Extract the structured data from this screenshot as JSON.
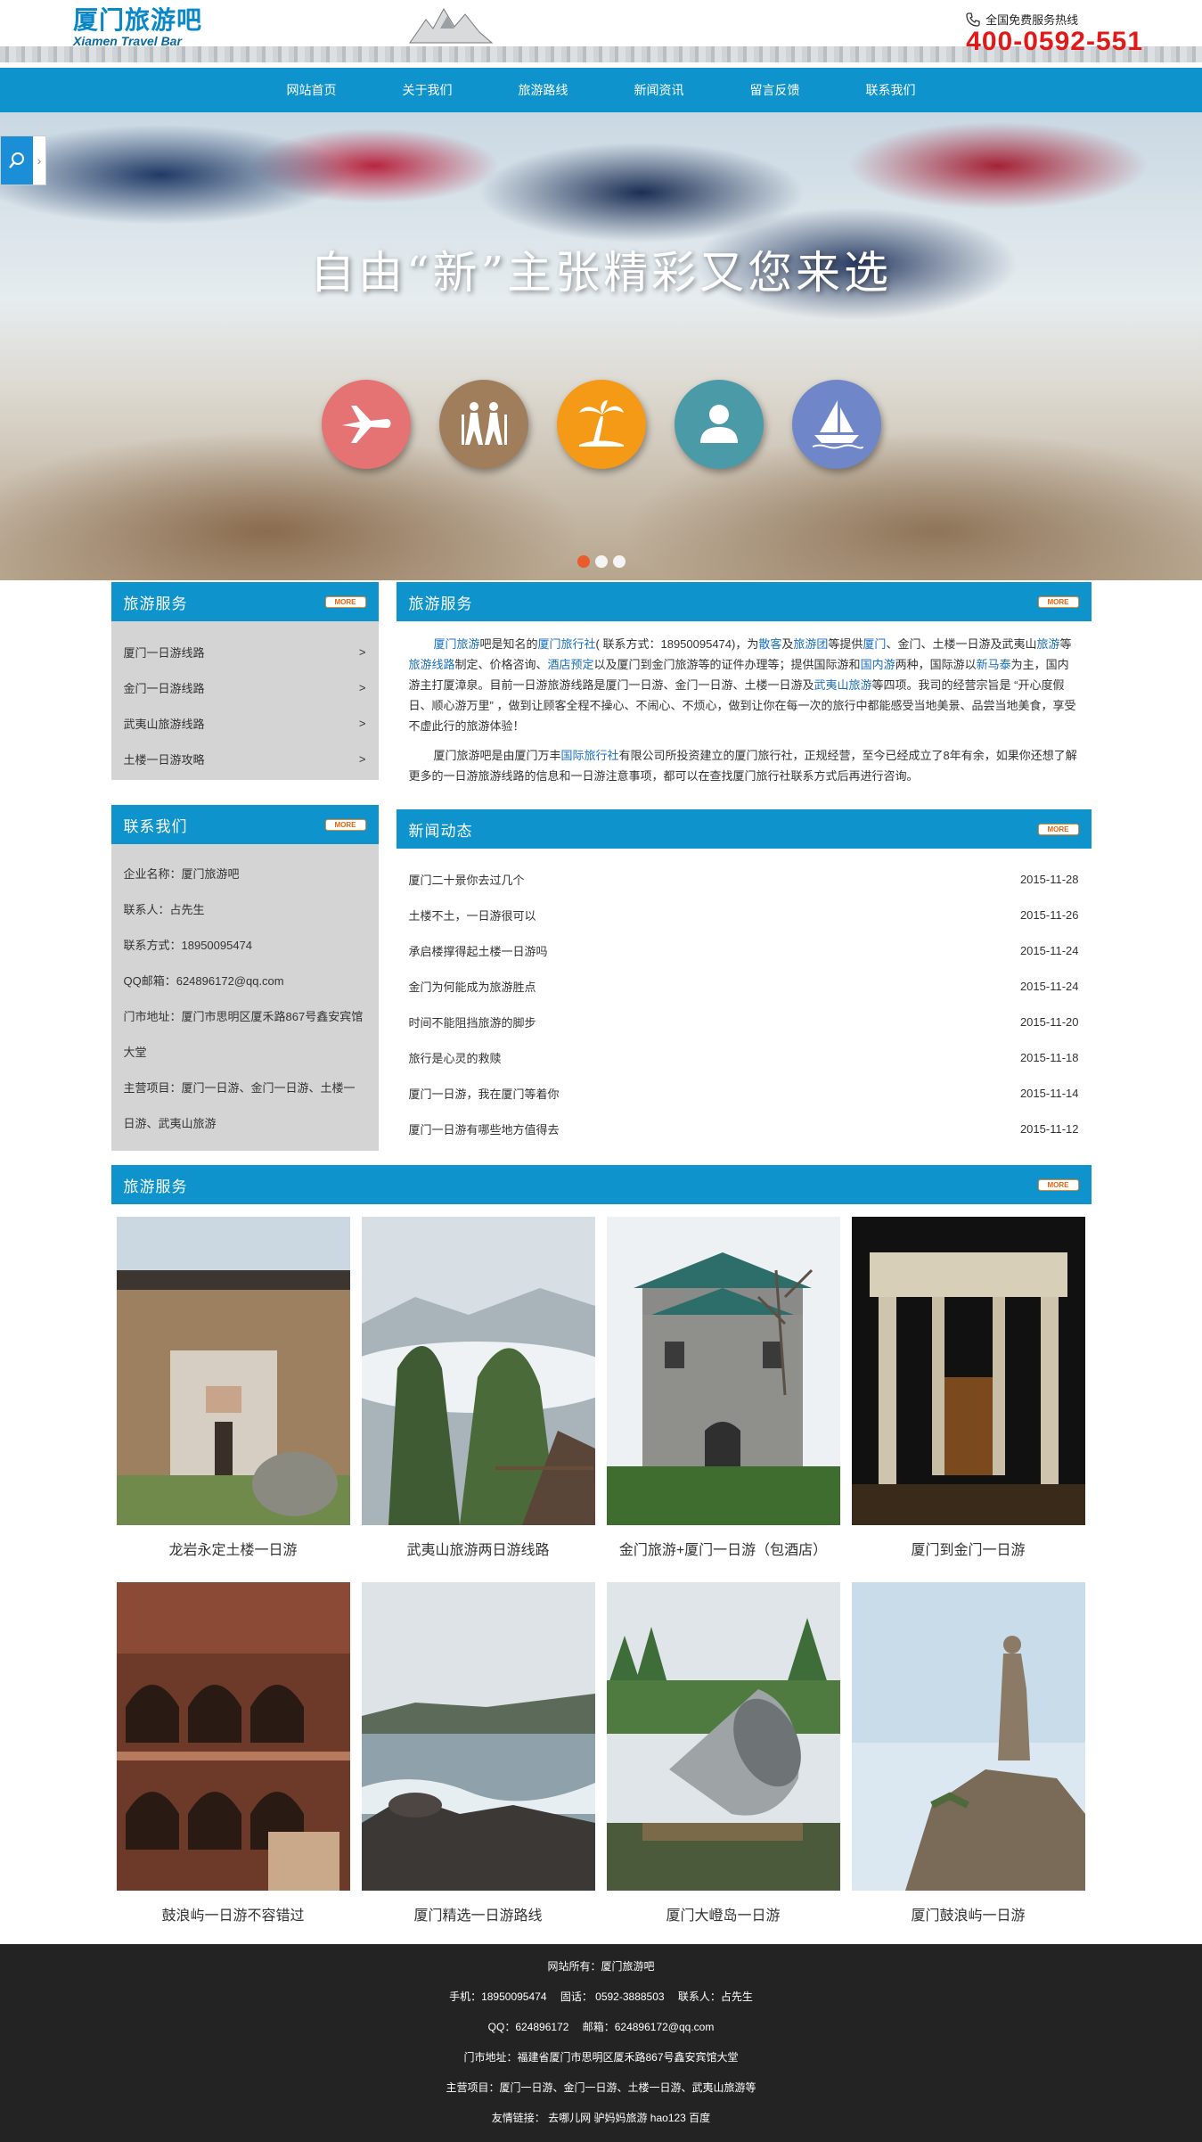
{
  "header": {
    "logo_cn": "厦门旅游吧",
    "logo_en": "Xiamen Travel Bar",
    "hotline_label": "全国免费服务热线",
    "hotline_number": "400-0592-551"
  },
  "nav": {
    "items": [
      "网站首页",
      "关于我们",
      "旅游路线",
      "新闻资讯",
      "留言反馈",
      "联系我们"
    ]
  },
  "banner": {
    "slogan": "自由“新”主张精彩又您来选",
    "icons": [
      "airplane-icon",
      "hikers-icon",
      "palm-tree-icon",
      "person-icon",
      "sailboat-icon"
    ],
    "icon_colors": [
      "#e57373",
      "#a07e5c",
      "#f59a17",
      "#4b9aa8",
      "#6f86c9"
    ],
    "active_slide": 1,
    "slide_count": 3
  },
  "colors": {
    "primary": "#0e93cc",
    "accent_red": "#e11919",
    "link": "#1a6fc2",
    "footer_bg": "#232323"
  },
  "more_label": "MORE",
  "sidebar": {
    "services_title": "旅游服务",
    "services": [
      {
        "label": "厦门一日游线路",
        "arrow": ">"
      },
      {
        "label": "金门一日游线路",
        "arrow": ">"
      },
      {
        "label": "武夷山旅游线路",
        "arrow": ">"
      },
      {
        "label": "土楼一日游攻略",
        "arrow": ">"
      }
    ],
    "contact_title": "联系我们",
    "contact": [
      "企业名称：厦门旅游吧",
      "联系人：占先生",
      "联系方式：18950095474",
      "QQ邮箱：624896172@qq.com",
      "门市地址：厦门市思明区厦禾路867号鑫安宾馆大堂",
      "主营项目：厦门一日游、金门一日游、土楼一日游、武夷山旅游"
    ]
  },
  "intro": {
    "title": "旅游服务",
    "p1": [
      {
        "t": "厦门旅游",
        "hl": true
      },
      {
        "t": "吧是知名的",
        "hl": false
      },
      {
        "t": "厦门旅行社",
        "hl": true
      },
      {
        "t": "( 联系方式：18950095474)，为",
        "hl": false
      },
      {
        "t": "散客",
        "hl": true
      },
      {
        "t": "及",
        "hl": false
      },
      {
        "t": "旅游团",
        "hl": true
      },
      {
        "t": "等提供",
        "hl": false
      },
      {
        "t": "厦门",
        "hl": true
      },
      {
        "t": "、金门、土楼一日游及武夷山",
        "hl": false
      },
      {
        "t": "旅游",
        "hl": true
      },
      {
        "t": "等",
        "hl": false
      },
      {
        "t": "旅游线路",
        "hl": true
      },
      {
        "t": "制定、价格咨询、",
        "hl": false
      },
      {
        "t": "酒店预定",
        "hl": true
      },
      {
        "t": "以及厦门到金门旅游等的证件办理等；提供国际游和",
        "hl": false
      },
      {
        "t": "国内游",
        "hl": true
      },
      {
        "t": "两种，国际游以",
        "hl": false
      },
      {
        "t": "新马泰",
        "hl": true
      },
      {
        "t": "为主，国内游主打厦漳泉。目前一日游旅游线路是厦门一日游、金门一日游、土楼一日游及",
        "hl": false
      },
      {
        "t": "武夷山旅游",
        "hl": true
      },
      {
        "t": "等四项。我司的经营宗旨是 “开心度假日、顺心游万里” ，做到让顾客全程不操心、不闹心、不烦心，做到让你在每一次的旅行中都能感受当地美景、品尝当地美食，享受不虚此行的旅游体验！",
        "hl": false
      }
    ],
    "p2": [
      {
        "t": "厦门旅游吧是由厦门万丰",
        "hl": false
      },
      {
        "t": "国际旅行社",
        "hl": true
      },
      {
        "t": "有限公司所投资建立的厦门旅行社，正规经营，至今已经成立了8年有余，如果你还想了解更多的一日游旅游线路的信息和一日游注意事项，都可以在查找厦门旅行社联系方式后再进行咨询。",
        "hl": false
      }
    ]
  },
  "news": {
    "title": "新闻动态",
    "items": [
      {
        "title": "厦门二十景你去过几个",
        "date": "2015-11-28"
      },
      {
        "title": "土楼不土，一日游很可以",
        "date": "2015-11-26"
      },
      {
        "title": "承启楼撑得起土楼一日游吗",
        "date": "2015-11-24"
      },
      {
        "title": "金门为何能成为旅游胜点",
        "date": "2015-11-24"
      },
      {
        "title": "时间不能阻挡旅游的脚步",
        "date": "2015-11-20"
      },
      {
        "title": "旅行是心灵的救赎",
        "date": "2015-11-18"
      },
      {
        "title": "厦门一日游，我在厦门等着你",
        "date": "2015-11-14"
      },
      {
        "title": "厦门一日游有哪些地方值得去",
        "date": "2015-11-12"
      }
    ]
  },
  "tours": {
    "title": "旅游服务",
    "items": [
      {
        "title": "龙岩永定土楼一日游",
        "scene": "tulou"
      },
      {
        "title": "武夷山旅游两日游线路",
        "scene": "mountain"
      },
      {
        "title": "金门旅游+厦门一日游（包酒店）",
        "scene": "tower"
      },
      {
        "title": "厦门到金门一日游",
        "scene": "gate"
      },
      {
        "title": "鼓浪屿一日游不容错过",
        "scene": "arches"
      },
      {
        "title": "厦门精选一日游路线",
        "scene": "coast"
      },
      {
        "title": "厦门大嶝岛一日游",
        "scene": "speaker"
      },
      {
        "title": "厦门鼓浪屿一日游",
        "scene": "statue"
      }
    ]
  },
  "footer": {
    "lines": [
      "网站所有：厦门旅游吧",
      "手机：18950095474　 固话： 0592-3888503　 联系人：占先生",
      "QQ：624896172　 邮箱：624896172@qq.com",
      "门市地址：福建省厦门市思明区厦禾路867号鑫安宾馆大堂",
      "主营项目：厦门一日游、金门一日游、土楼一日游、武夷山旅游等",
      "友情链接： 去哪儿网 驴妈妈旅游 hao123 百度"
    ]
  }
}
